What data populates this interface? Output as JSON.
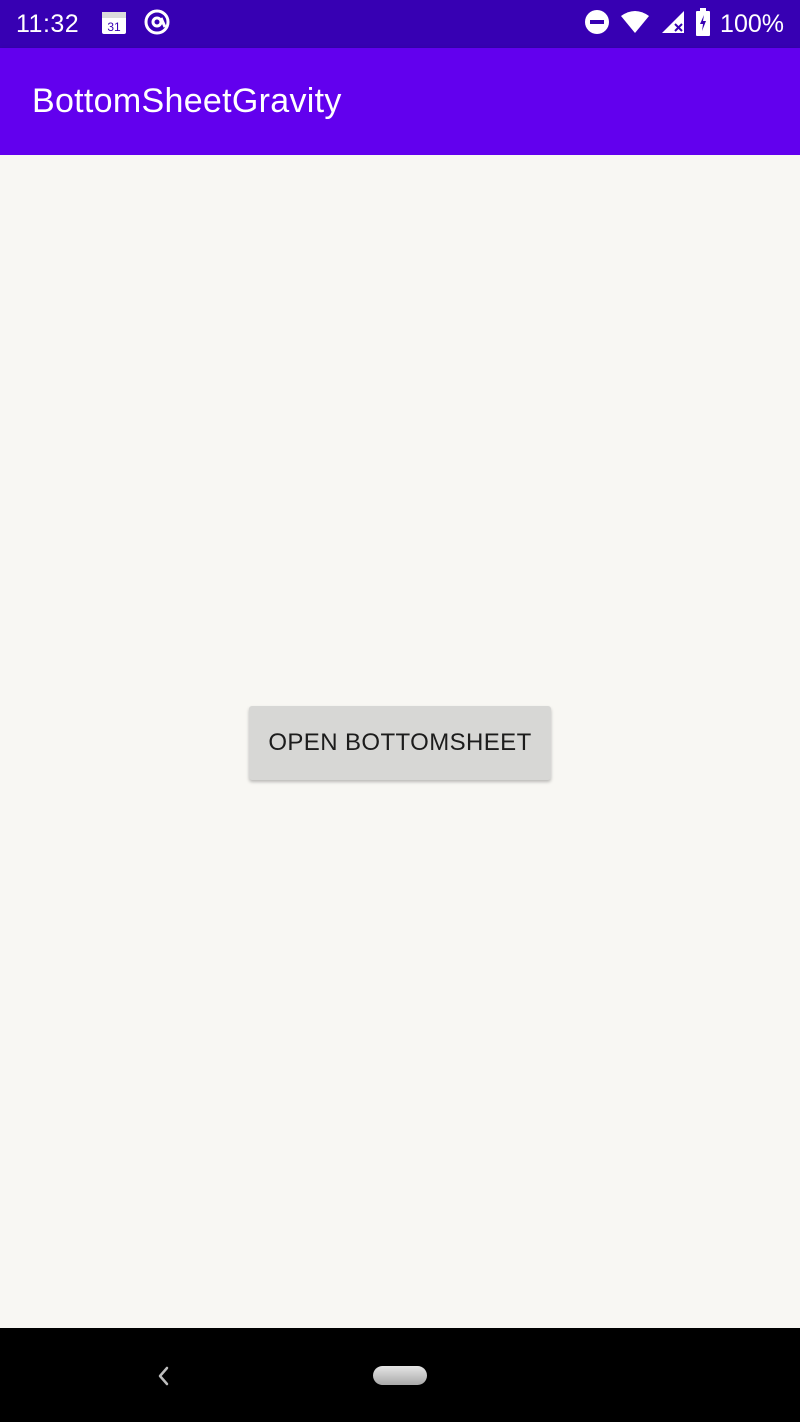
{
  "status_bar": {
    "time": "11:32",
    "calendar_day": "31",
    "battery_percent": "100%",
    "icons": [
      "calendar-icon",
      "at-sign-icon",
      "do-not-disturb-icon",
      "wifi-icon",
      "cell-signal-icon",
      "battery-icon"
    ]
  },
  "app_bar": {
    "title": "BottomSheetGravity"
  },
  "main": {
    "open_button_label": "OPEN BOTTOMSHEET"
  },
  "nav_bar": {
    "icons": [
      "back-icon",
      "home-pill-icon"
    ]
  },
  "colors": {
    "status_bar": "#3700b3",
    "app_bar": "#6200ee",
    "background": "#f8f7f3",
    "button": "#d7d7d5"
  }
}
